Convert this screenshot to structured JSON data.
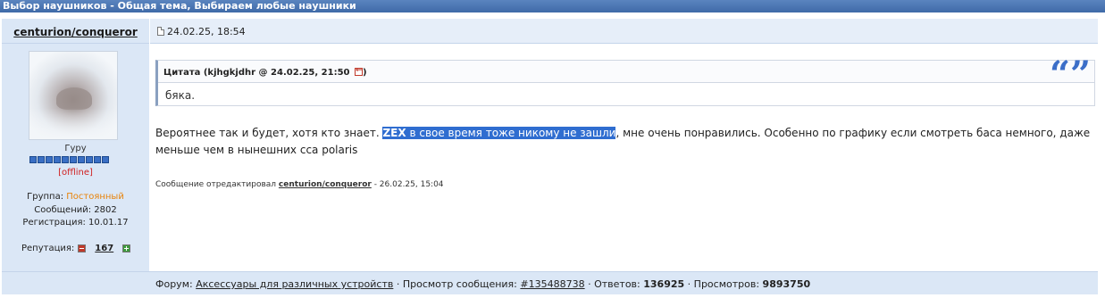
{
  "window": {
    "title": "Выбор наушников - Общая тема, Выбираем любые наушники"
  },
  "post": {
    "author": "centurion/conqueror",
    "date": "24.02.25, 18:54",
    "quote": {
      "title": "Цитата (kjhgkjdhr @ 24.02.25, 21:50",
      "title_close": ")",
      "text": "бяка.",
      "quote_icon": "quote-marks-icon"
    },
    "text_before": "Вероятнее так и будет, хотя кто знает. ",
    "highlight_bold": "ZEX",
    "highlight_rest": " в свое время тоже никому не зашли",
    "text_after": ", мне очень понравились. Особенно по графику если смотреть баса немного, даже меньше чем в нынешних cca polaris",
    "edited_prefix": "Сообщение отредактировал ",
    "edited_by": "centurion/conqueror",
    "edited_suffix": " - 26.02.25, 15:04"
  },
  "profile": {
    "rank": "Гуру",
    "pips": 10,
    "status": "[offline]",
    "group_label": "Группа: ",
    "group_value": "Постоянный",
    "messages": "Сообщений: 2802",
    "registered": "Регистрация: 10.01.17",
    "rep_label": "Репутация:",
    "rep_value": "167"
  },
  "footer": {
    "forum_label": "Форум: ",
    "forum_link": "Аксессуары для различных устройств",
    "view_label": " · Просмотр сообщения: ",
    "view_link": "#135488738",
    "replies_label": " · Ответов: ",
    "replies_value": "136925",
    "views_label": " · Просмотров: ",
    "views_value": "9893750"
  },
  "colors": {
    "titlebar": "#4874b3",
    "panel": "#dbe7f6",
    "highlight": "#2f6dd0",
    "offline": "#d02020",
    "group": "#e8830a",
    "quote_mark": "#3b6ec8"
  }
}
